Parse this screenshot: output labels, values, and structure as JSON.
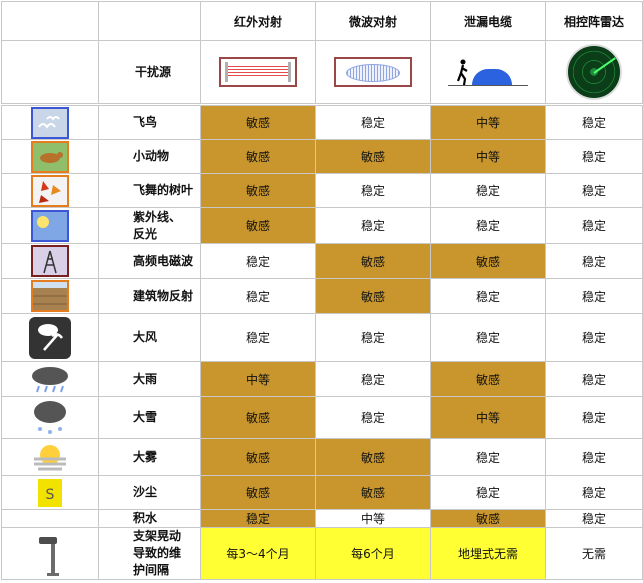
{
  "headers": [
    "",
    "",
    "红外对射",
    "微波对射",
    "泄漏电缆",
    "相控阵雷达"
  ],
  "source_row_label": "干扰源",
  "source_icons": [
    "infrared-beam-icon",
    "microwave-beam-icon",
    "leaky-cable-icon",
    "phased-radar-icon"
  ],
  "rows": [
    {
      "label": "飞鸟",
      "icon": "birds-icon",
      "values": [
        "敏感",
        "稳定",
        "中等",
        "稳定"
      ],
      "bg": [
        "s",
        "w",
        "s",
        "w"
      ]
    },
    {
      "label": "小动物",
      "icon": "small-animal-icon",
      "values": [
        "敏感",
        "敏感",
        "中等",
        "稳定"
      ],
      "bg": [
        "s",
        "s",
        "s",
        "w"
      ]
    },
    {
      "label": "飞舞的树叶",
      "icon": "leaves-icon",
      "values": [
        "敏感",
        "稳定",
        "稳定",
        "稳定"
      ],
      "bg": [
        "s",
        "w",
        "w",
        "w"
      ]
    },
    {
      "label": "紫外线、反光",
      "icon": "sunlight-icon",
      "values": [
        "敏感",
        "稳定",
        "稳定",
        "稳定"
      ],
      "bg": [
        "s",
        "w",
        "w",
        "w"
      ]
    },
    {
      "label": "高频电磁波",
      "icon": "radio-tower-icon",
      "values": [
        "稳定",
        "敏感",
        "敏感",
        "稳定"
      ],
      "bg": [
        "w",
        "s",
        "s",
        "w"
      ]
    },
    {
      "label": "建筑物反射",
      "icon": "building-wall-icon",
      "values": [
        "稳定",
        "敏感",
        "稳定",
        "稳定"
      ],
      "bg": [
        "w",
        "s",
        "w",
        "w"
      ]
    },
    {
      "label": "大风",
      "icon": "wind-umbrella-icon",
      "values": [
        "稳定",
        "稳定",
        "稳定",
        "稳定"
      ],
      "bg": [
        "w",
        "w",
        "w",
        "w"
      ]
    },
    {
      "label": "大雨",
      "icon": "heavy-rain-icon",
      "values": [
        "中等",
        "稳定",
        "敏感",
        "稳定"
      ],
      "bg": [
        "s",
        "w",
        "s",
        "w"
      ]
    },
    {
      "label": "大雪",
      "icon": "heavy-snow-icon",
      "values": [
        "敏感",
        "稳定",
        "中等",
        "稳定"
      ],
      "bg": [
        "s",
        "w",
        "s",
        "w"
      ]
    },
    {
      "label": "大雾",
      "icon": "fog-icon",
      "values": [
        "敏感",
        "敏感",
        "稳定",
        "稳定"
      ],
      "bg": [
        "s",
        "s",
        "w",
        "w"
      ]
    },
    {
      "label": "沙尘",
      "icon": "sandstorm-icon",
      "values": [
        "敏感",
        "敏感",
        "稳定",
        "稳定"
      ],
      "bg": [
        "s",
        "s",
        "w",
        "w"
      ]
    },
    {
      "label": "积水",
      "icon": "",
      "values": [
        "稳定",
        "中等",
        "敏感",
        "稳定"
      ],
      "bg": [
        "s",
        "w",
        "s",
        "w"
      ]
    },
    {
      "label": "支架晃动导致的维护间隔",
      "icon": "camera-pole-icon",
      "values": [
        "每3～4个月",
        "每6个月",
        "地埋式无需",
        "无需"
      ],
      "bg": [
        "y",
        "y",
        "y",
        "w"
      ]
    }
  ],
  "colors": {
    "sensitive": "#c8962d",
    "highlight": "#ffff33",
    "border": "#c8c8c8"
  }
}
